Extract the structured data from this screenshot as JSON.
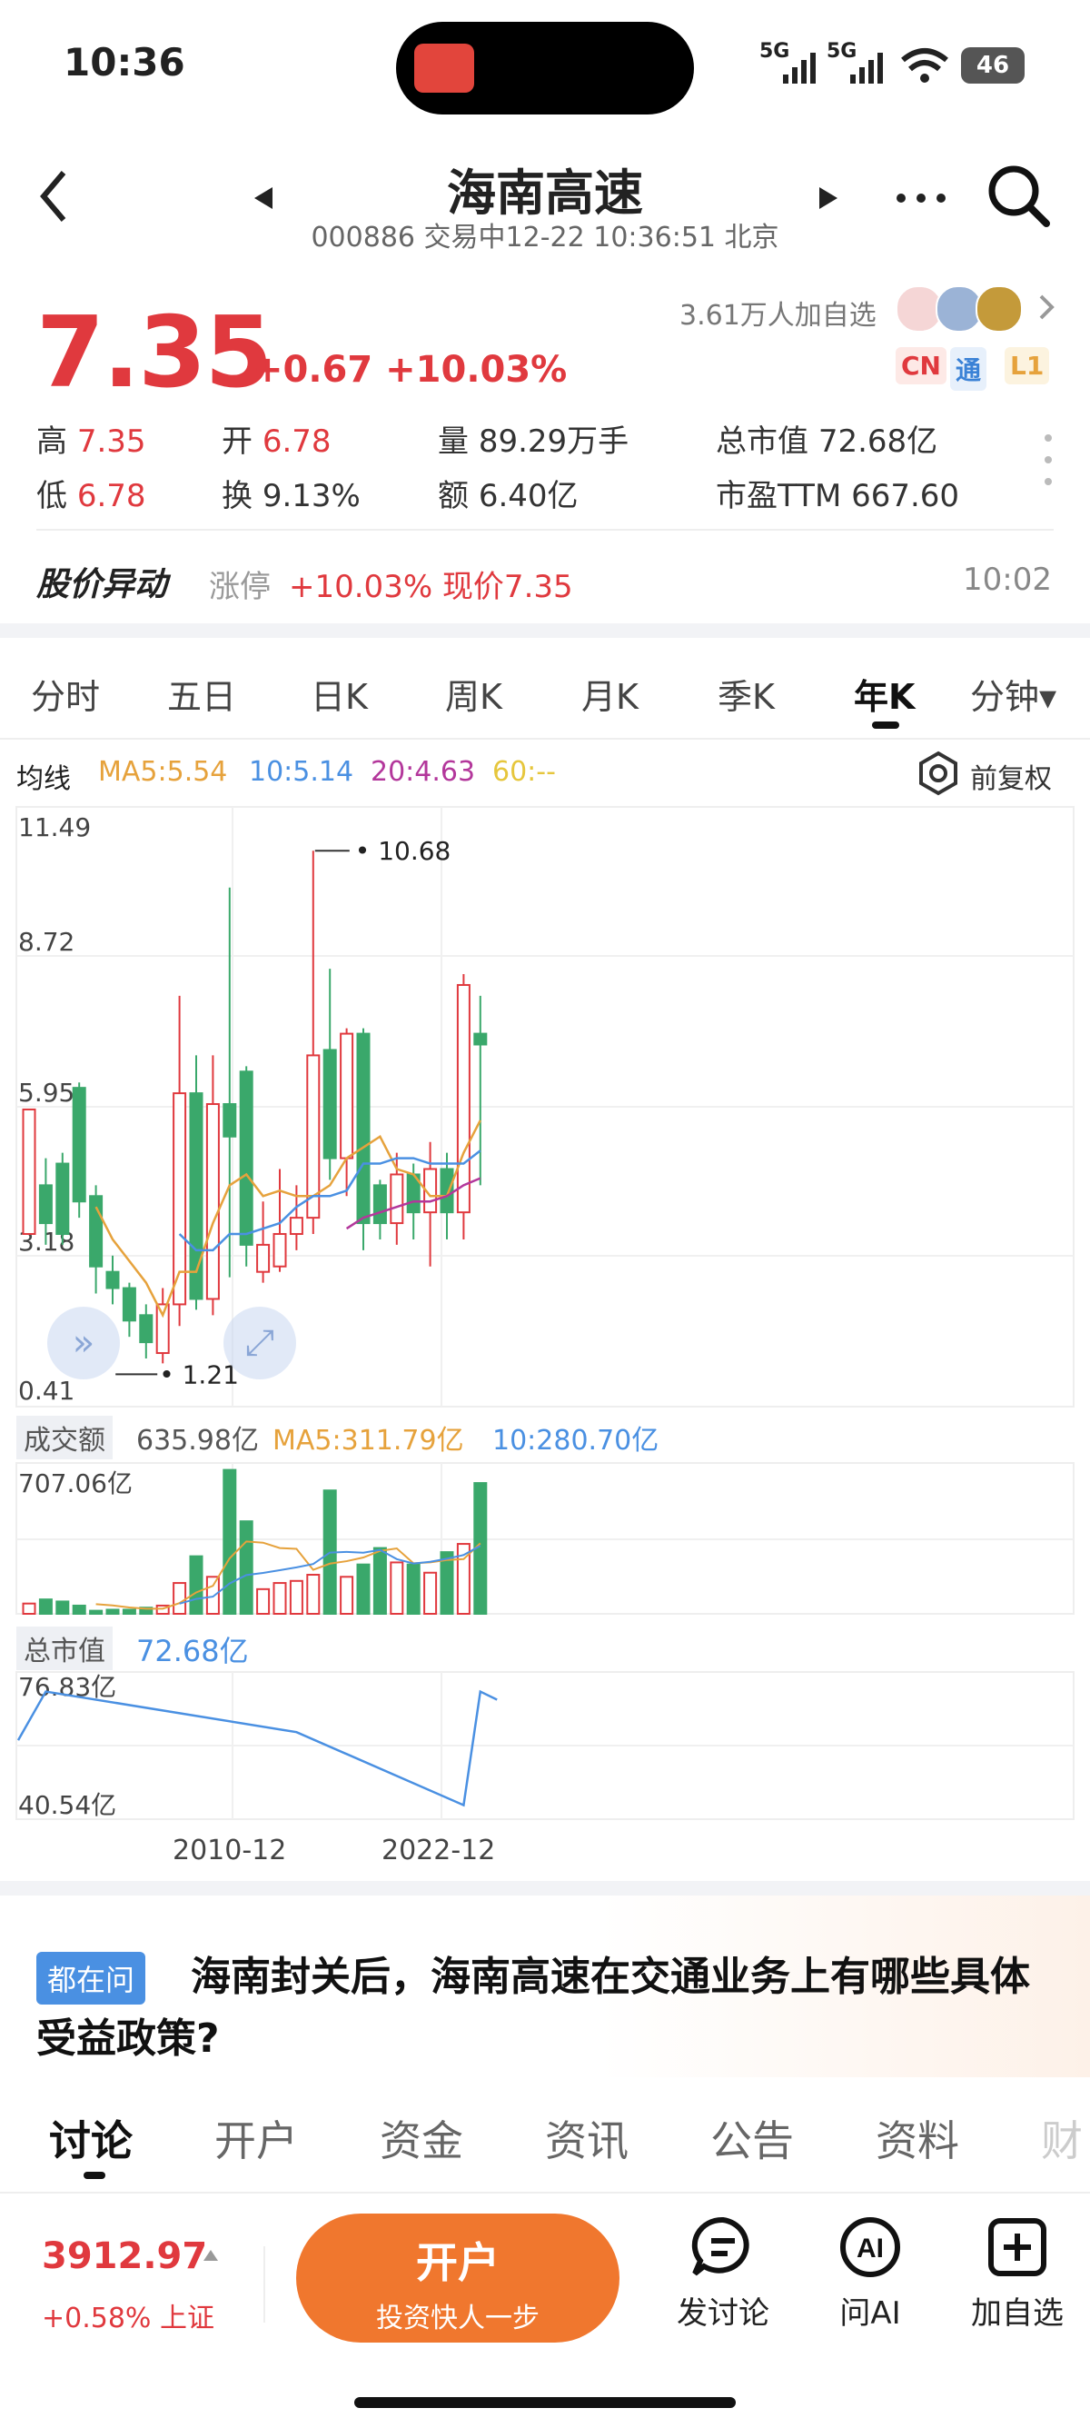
{
  "status_bar": {
    "time": "10:36",
    "net1": "5G",
    "net2": "5G",
    "battery": "46"
  },
  "header": {
    "title": "海南高速",
    "code": "000886",
    "status": "交易中12-22 10:36:51 北京",
    "back_icon": "chevron-left-icon",
    "prev_icon": "triangle-left-icon",
    "next_icon": "triangle-right-icon",
    "more_icon": "more-dots-icon",
    "search_icon": "search-icon"
  },
  "quote": {
    "price": "7.35",
    "change": "+0.67 +10.03%",
    "followers": "3.61万人加自选",
    "badges": [
      "CN",
      "通",
      "L1"
    ],
    "stats": [
      {
        "label": "高",
        "value": "7.35",
        "red": true
      },
      {
        "label": "开",
        "value": "6.78",
        "red": true
      },
      {
        "label": "量",
        "value": "89.29万手",
        "red": false
      },
      {
        "label": "总市值",
        "value": "72.68亿",
        "red": false
      },
      {
        "label": "低",
        "value": "6.78",
        "red": true
      },
      {
        "label": "换",
        "value": "9.13%",
        "red": false
      },
      {
        "label": "额",
        "value": "6.40亿",
        "red": false
      },
      {
        "label": "市盈TTM",
        "value": "667.60",
        "red": false
      }
    ]
  },
  "alert": {
    "title": "股价异动",
    "tag": "涨停",
    "value": "+10.03% 现价7.35",
    "time": "10:02"
  },
  "chart_tabs": [
    "分时",
    "五日",
    "日K",
    "周K",
    "月K",
    "季K",
    "年K",
    "分钟▾"
  ],
  "active_chart_tab": "年K",
  "ma": {
    "label": "均线",
    "ma5": "MA5:5.54",
    "ma10": "10:5.14",
    "ma20": "20:4.63",
    "ma60": "60:--",
    "adjust": "前复权"
  },
  "colors": {
    "up": "#e0393e",
    "down": "#3aa86b",
    "ma5": "#e6a23c",
    "ma10": "#4a90e2",
    "ma20": "#b3379b",
    "ma60": "#e6c63c",
    "accent": "#f0772e"
  },
  "chart_data": {
    "type": "candlestick",
    "price_axis_labels": [
      "11.49",
      "8.72",
      "5.95",
      "3.18",
      "0.41"
    ],
    "ylim": [
      0.41,
      11.49
    ],
    "max_marker": "10.68",
    "min_marker": "1.21",
    "candles": [
      {
        "o": 3.6,
        "c": 5.9,
        "h": 5.9,
        "l": 3.6
      },
      {
        "o": 4.5,
        "c": 3.8,
        "h": 5.0,
        "l": 3.4
      },
      {
        "o": 4.9,
        "c": 3.6,
        "h": 5.1,
        "l": 3.4
      },
      {
        "o": 6.3,
        "c": 4.2,
        "h": 6.4,
        "l": 3.9
      },
      {
        "o": 4.3,
        "c": 3.0,
        "h": 4.5,
        "l": 2.5
      },
      {
        "o": 2.9,
        "c": 2.6,
        "h": 3.2,
        "l": 2.3
      },
      {
        "o": 2.6,
        "c": 2.0,
        "h": 2.7,
        "l": 1.7
      },
      {
        "o": 2.1,
        "c": 1.6,
        "h": 2.3,
        "l": 1.3
      },
      {
        "o": 1.4,
        "c": 2.3,
        "h": 2.6,
        "l": 1.21
      },
      {
        "o": 2.3,
        "c": 6.2,
        "h": 8.0,
        "l": 1.9
      },
      {
        "o": 6.2,
        "c": 2.4,
        "h": 6.9,
        "l": 2.2
      },
      {
        "o": 2.4,
        "c": 6.0,
        "h": 6.9,
        "l": 2.1
      },
      {
        "o": 6.0,
        "c": 5.4,
        "h": 10.0,
        "l": 2.8
      },
      {
        "o": 6.6,
        "c": 3.4,
        "h": 6.7,
        "l": 3.0
      },
      {
        "o": 2.9,
        "c": 3.4,
        "h": 4.2,
        "l": 2.7
      },
      {
        "o": 3.0,
        "c": 3.6,
        "h": 4.8,
        "l": 2.9
      },
      {
        "o": 3.6,
        "c": 3.9,
        "h": 4.5,
        "l": 3.3
      },
      {
        "o": 3.9,
        "c": 6.9,
        "h": 10.68,
        "l": 3.6
      },
      {
        "o": 7.0,
        "c": 5.0,
        "h": 8.5,
        "l": 4.6
      },
      {
        "o": 5.0,
        "c": 7.3,
        "h": 7.4,
        "l": 4.3
      },
      {
        "o": 7.3,
        "c": 3.8,
        "h": 7.4,
        "l": 3.3
      },
      {
        "o": 4.5,
        "c": 3.8,
        "h": 4.6,
        "l": 3.5
      },
      {
        "o": 3.8,
        "c": 4.7,
        "h": 5.1,
        "l": 3.4
      },
      {
        "o": 4.7,
        "c": 4.0,
        "h": 4.9,
        "l": 3.5
      },
      {
        "o": 4.0,
        "c": 4.8,
        "h": 5.3,
        "l": 3.0
      },
      {
        "o": 4.8,
        "c": 4.0,
        "h": 5.1,
        "l": 3.5
      },
      {
        "o": 4.0,
        "c": 8.2,
        "h": 8.4,
        "l": 3.5
      },
      {
        "o": 7.3,
        "c": 7.1,
        "h": 8.0,
        "l": 4.5
      }
    ],
    "ma5": [
      null,
      null,
      null,
      null,
      4.1,
      3.5,
      3.1,
      2.7,
      2.1,
      2.9,
      2.9,
      3.8,
      4.5,
      4.7,
      4.3,
      4.4,
      4.3,
      4.3,
      4.5,
      5.0,
      5.2,
      5.4,
      4.8,
      4.7,
      4.3,
      4.3,
      5.1,
      5.7
    ],
    "ma10": [
      null,
      null,
      null,
      null,
      null,
      null,
      null,
      null,
      null,
      3.6,
      3.3,
      3.3,
      3.6,
      3.6,
      3.7,
      3.8,
      4.1,
      4.3,
      4.3,
      4.4,
      4.9,
      4.9,
      5.0,
      5.0,
      4.9,
      4.9,
      4.9,
      5.14
    ],
    "ma20": [
      null,
      null,
      null,
      null,
      null,
      null,
      null,
      null,
      null,
      null,
      null,
      null,
      null,
      null,
      null,
      null,
      null,
      null,
      null,
      3.7,
      3.9,
      4.0,
      4.1,
      4.2,
      4.2,
      4.3,
      4.5,
      4.63
    ],
    "volume": {
      "label": "成交额",
      "value": "635.98亿",
      "ma5": "MA5:311.79亿",
      "ma10": "10:280.70亿",
      "axis_max": "707.06亿",
      "values": [
        50,
        70,
        60,
        40,
        15,
        20,
        20,
        30,
        40,
        150,
        280,
        180,
        700,
        450,
        120,
        150,
        160,
        190,
        600,
        180,
        240,
        320,
        250,
        240,
        200,
        300,
        340,
        636
      ],
      "up": [
        true,
        false,
        false,
        false,
        false,
        false,
        false,
        false,
        true,
        true,
        false,
        true,
        false,
        false,
        true,
        true,
        true,
        true,
        false,
        true,
        false,
        false,
        true,
        false,
        true,
        false,
        true,
        false
      ]
    },
    "market_cap": {
      "label": "总市值",
      "value": "72.68亿",
      "axis_max": "76.83亿",
      "axis_min": "40.54亿",
      "points": [
        [
          0,
          60
        ],
        [
          1,
          72
        ],
        [
          16,
          62
        ],
        [
          26,
          44
        ],
        [
          27,
          72
        ],
        [
          28,
          70
        ]
      ],
      "x_labels": [
        "2010-12",
        "2022-12"
      ]
    }
  },
  "question": {
    "tag": "都在问",
    "text": "海南封关后，海南高速在交通业务上有哪些具体受益政策?"
  },
  "bottom_tabs": [
    "讨论",
    "开户",
    "资金",
    "资讯",
    "公告",
    "资料",
    "财"
  ],
  "bottom_bar": {
    "index_value": "3912.97",
    "index_change": "+0.58% 上证",
    "cta_main": "开户",
    "cta_sub": "投资快人一步",
    "actions": [
      {
        "label": "发讨论",
        "icon": "chat-icon"
      },
      {
        "label": "问AI",
        "icon": "ai-icon"
      },
      {
        "label": "加自选",
        "icon": "add-watchlist-icon"
      }
    ]
  }
}
